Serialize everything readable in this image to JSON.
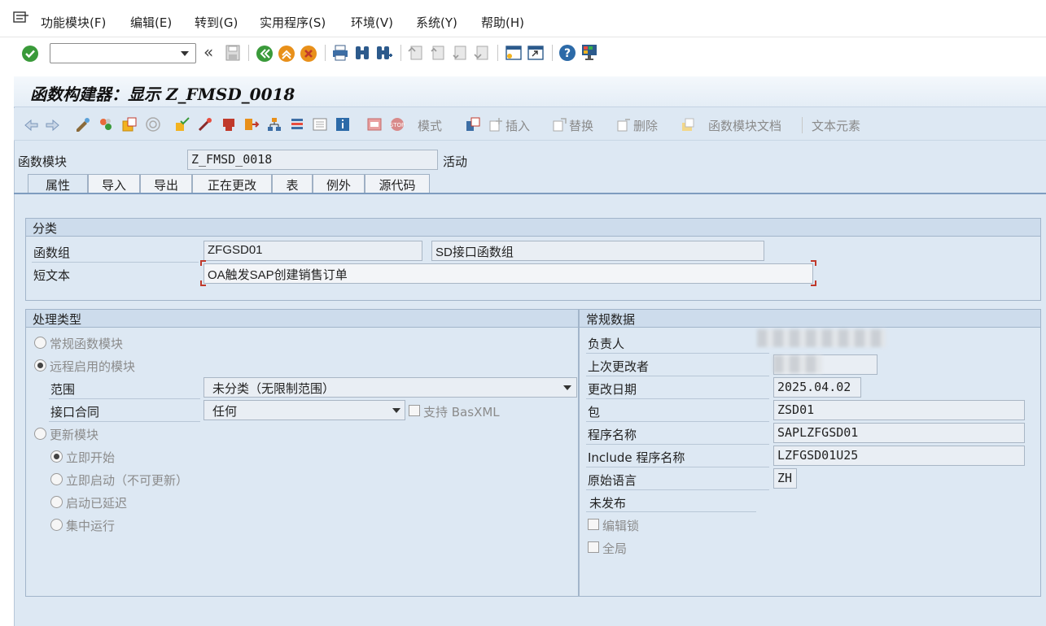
{
  "menubar": {
    "items": [
      "功能模块(F)",
      "编辑(E)",
      "转到(G)",
      "实用程序(S)",
      "环境(V)",
      "系统(Y)",
      "帮助(H)"
    ]
  },
  "toolbar": {
    "command_value": "",
    "back_glyph": "«"
  },
  "title": "函数构建器：显示 Z_FMSD_0018",
  "app_toolbar": {
    "mode_label": "模式",
    "insert_label": "插入",
    "replace_label": "替换",
    "delete_label": "删除",
    "fm_doc_label": "函数模块文档",
    "text_elements_label": "文本元素"
  },
  "header": {
    "fm_label": "函数模块",
    "fm_value": "Z_FMSD_0018",
    "status": "活动"
  },
  "tabs": [
    "属性",
    "导入",
    "导出",
    "正在更改",
    "表",
    "例外",
    "源代码"
  ],
  "classification": {
    "title": "分类",
    "group_label": "函数组",
    "group_value": "ZFGSD01",
    "group_desc": "SD接口函数组",
    "short_text_label": "短文本",
    "short_text_value": "OA触发SAP创建销售订单"
  },
  "processing": {
    "title": "处理类型",
    "normal_fm": "常规函数模块",
    "remote_enabled": "远程启用的模块",
    "scope_label": "范围",
    "scope_value": "未分类（无限制范围）",
    "interface_label": "接口合同",
    "interface_value": "任何",
    "basxml_label": "支持 BasXML",
    "update_module": "更新模块",
    "start_immediately": "立即开始",
    "start_no_update": "立即启动（不可更新）",
    "start_delayed": "启动已延迟",
    "collective_run": "集中运行"
  },
  "general": {
    "title": "常规数据",
    "responsible_label": "负责人",
    "last_changed_by_label": "上次更改者",
    "changed_on_label": "更改日期",
    "changed_on_value": "2025.04.02",
    "package_label": "包",
    "package_value": "ZSD01",
    "program_label": "程序名称",
    "program_value": "SAPLZFGSD01",
    "include_label": "Include 程序名称",
    "include_value": "LZFGSD01U25",
    "lang_label": "原始语言",
    "lang_value": "ZH",
    "not_released": "未发布",
    "edit_lock_label": "编辑锁",
    "global_label": "全局"
  },
  "colors": {
    "screen_bg": "#dde8f3",
    "panel_header": "#cddcec",
    "accent_green": "#3a9a3a",
    "accent_orange": "#e8901a",
    "accent_red": "#c0392b"
  }
}
